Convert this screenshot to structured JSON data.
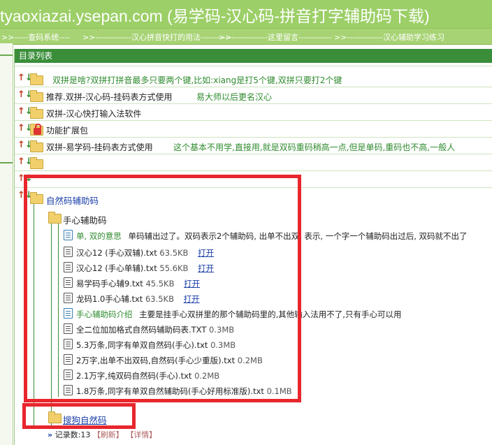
{
  "header": {
    "title": "tyaoxiazai.ysepan.com (易学码-汉心码-拼音打字辅助码下载)"
  },
  "nav": {
    "items": [
      ">>-----查码系统----",
      ">>-------------汉心拼音快打的用法------------",
      ">>-------------这里留言------------",
      ">>-------------汉心辅助学习练习"
    ]
  },
  "panel": {
    "title": "目录列表"
  },
  "rows": [
    {
      "name": "双拼是啥?双拼打拼音最多只要两个键,比如:xiang是打5个键,双拼只要打2个键",
      "desc": ""
    },
    {
      "name": "推荐.双拼-汉心码-挂码表方式使用",
      "desc": "易大师以后更名汉心"
    },
    {
      "name": "双拼-汉心快打输入法软件",
      "desc": ""
    },
    {
      "name": "功能扩展包",
      "desc": ""
    },
    {
      "name": "双拼-易学码-挂码表方式使用",
      "desc": "这个基本不用学,直接用,就是双码重码稍高一点,但是单码,重码也不高,一般人"
    }
  ],
  "tree": {
    "root": "自然码辅助码",
    "sub": "手心辅助码",
    "files": [
      {
        "name": "单, 双的意思",
        "size": "",
        "desc": "单码辅出过了。双码表示2个辅助码, 出单不出双, 表示, 一个字一个辅助码出过后, 双码就不出了",
        "open": ""
      },
      {
        "name": "汉心12 (手心双辅).txt",
        "size": "63.5KB",
        "desc": "",
        "open": "打开"
      },
      {
        "name": "汉心12 (手心单辅).txt",
        "size": "55.6KB",
        "desc": "",
        "open": "打开"
      },
      {
        "name": "易学码手心辅9.txt",
        "size": "45.5KB",
        "desc": "",
        "open": "打开"
      },
      {
        "name": "龙码1.0手心辅.txt",
        "size": "63.5KB",
        "desc": "",
        "open": "打开"
      },
      {
        "name": "手心辅助码介绍",
        "size": "",
        "desc": "主要是挂手心双拼里的那个辅助码里的,其他输入法用不了,只有手心可以用",
        "open": ""
      },
      {
        "name": "全二位加加格式自然码辅助码表.TXT",
        "size": "0.3MB",
        "desc": "",
        "open": ""
      },
      {
        "name": "5.3万条,同字有单双自然码(手心).txt",
        "size": "0.3MB",
        "desc": "",
        "open": ""
      },
      {
        "name": "2万字,出单不出双码,自然码(手心少重版).txt",
        "size": "0.2MB",
        "desc": "",
        "open": ""
      },
      {
        "name": "2.1万字,纯双码自然码(手心).txt",
        "size": "0.2MB",
        "desc": "",
        "open": ""
      },
      {
        "name": "1.8万条,同字有单双自然辅助码(手心好用标准版).txt",
        "size": "0.1MB",
        "desc": "",
        "open": ""
      }
    ],
    "sibling": "搜狗自然码"
  },
  "footer": {
    "arrows": "»",
    "count": "记录数:13",
    "refresh": "【刷新】",
    "detail": "【详情】"
  },
  "colors": {
    "header": "#9ccf67",
    "panel_head": "#3a8e3a",
    "highlight": "#e8262c"
  }
}
